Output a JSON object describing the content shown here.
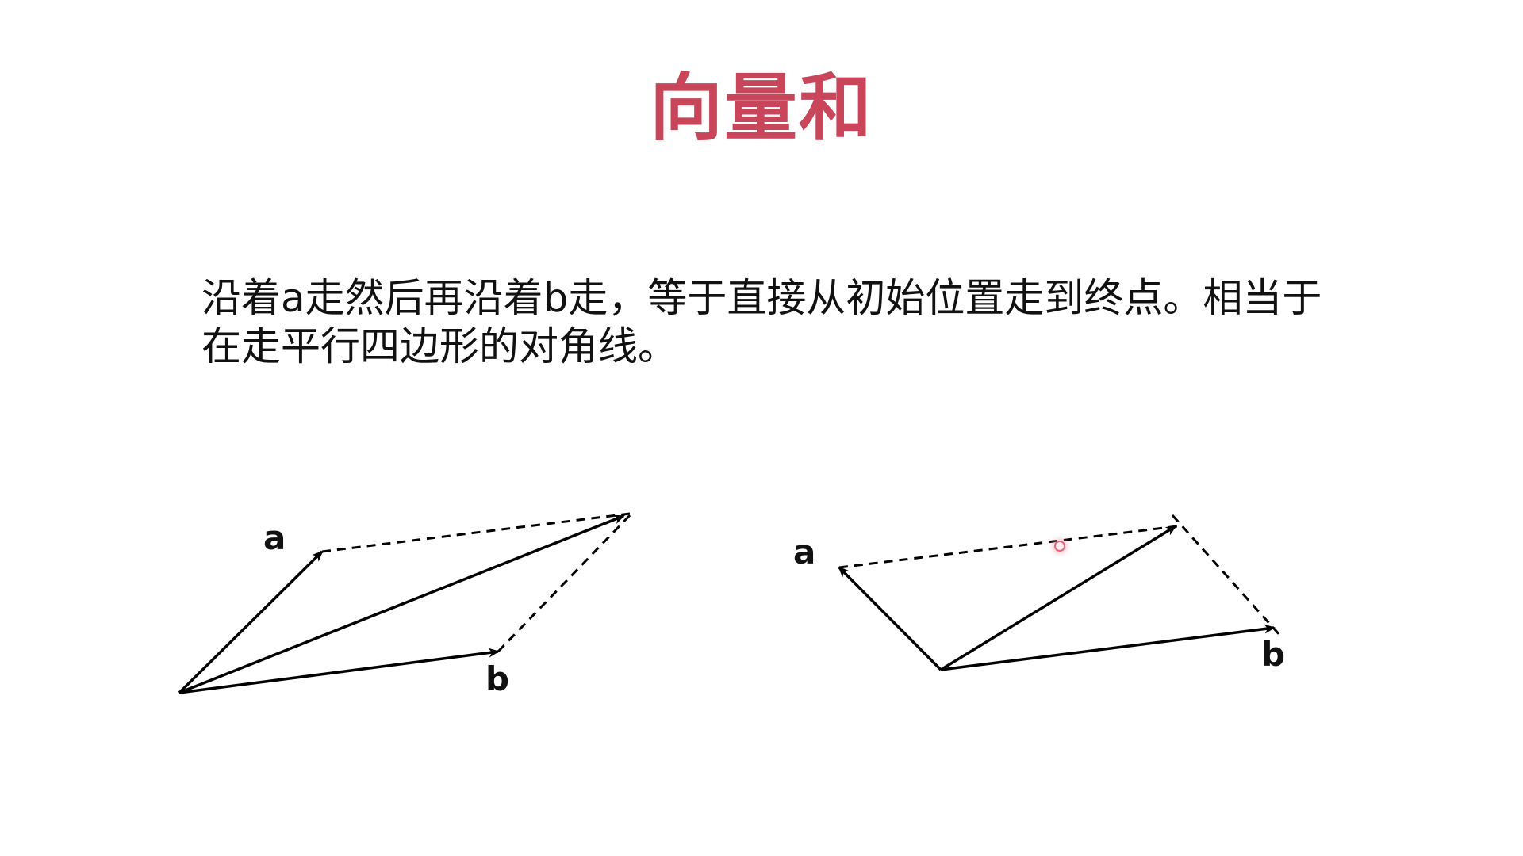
{
  "slide": {
    "title": "向量和",
    "paragraph_lines": [
      "沿着a走然后再沿着b走，等于直接从初始位置走到终点。相当于",
      "在走平行四边形的对角线。"
    ]
  },
  "diagrams": [
    {
      "vector_labels": [
        "a",
        "b"
      ]
    },
    {
      "vector_labels": [
        "a",
        "b"
      ]
    }
  ],
  "colors": {
    "title": "#c8455a",
    "text": "#111111",
    "line": "#000000",
    "background": "#ffffff"
  }
}
